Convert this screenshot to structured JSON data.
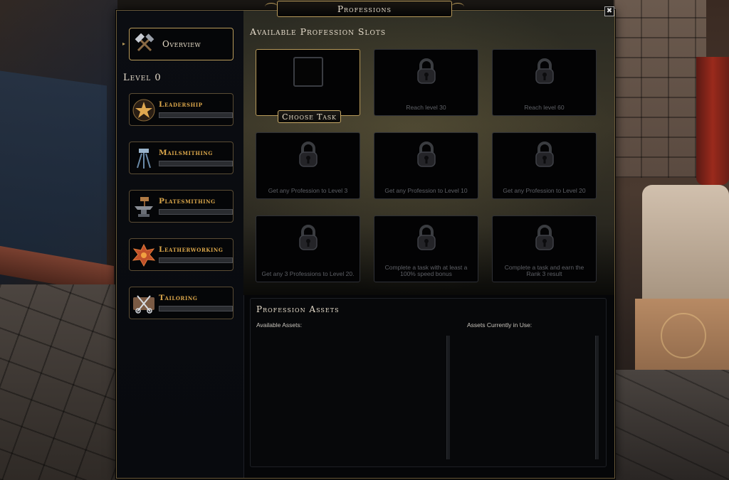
{
  "window": {
    "title": "Professions",
    "close_glyph": "✖"
  },
  "sidebar": {
    "overview_label": "Overview",
    "level_label": "Level 0",
    "professions": [
      {
        "name": "Leadership",
        "icon": "leadership-star-icon",
        "progress": 0
      },
      {
        "name": "Mailsmithing",
        "icon": "mailsmithing-hammers-icon",
        "progress": 0
      },
      {
        "name": "Platesmithing",
        "icon": "platesmithing-anvil-icon",
        "progress": 0
      },
      {
        "name": "Leatherworking",
        "icon": "leatherworking-hide-icon",
        "progress": 0
      },
      {
        "name": "Tailoring",
        "icon": "tailoring-scissors-icon",
        "progress": 0
      }
    ]
  },
  "slots": {
    "heading": "Available Profession Slots",
    "choose_task_label": "Choose Task",
    "locked": [
      "Reach level 30",
      "Reach level 60",
      "Get any Profession to Level 3",
      "Get any Profession to Level 10",
      "Get any Profession to Level 20",
      "Get any 3 Professions to Level 20.",
      "Complete a task with at least a 100% speed bonus",
      "Complete a task and earn the Rank 3 result"
    ]
  },
  "assets": {
    "heading": "Profession Assets",
    "available_label": "Available Assets:",
    "in_use_label": "Assets Currently in Use:"
  },
  "colors": {
    "gold_border": "#b89a5a",
    "profession_name": "#d9a54a",
    "locked_text": "#5e6066"
  }
}
